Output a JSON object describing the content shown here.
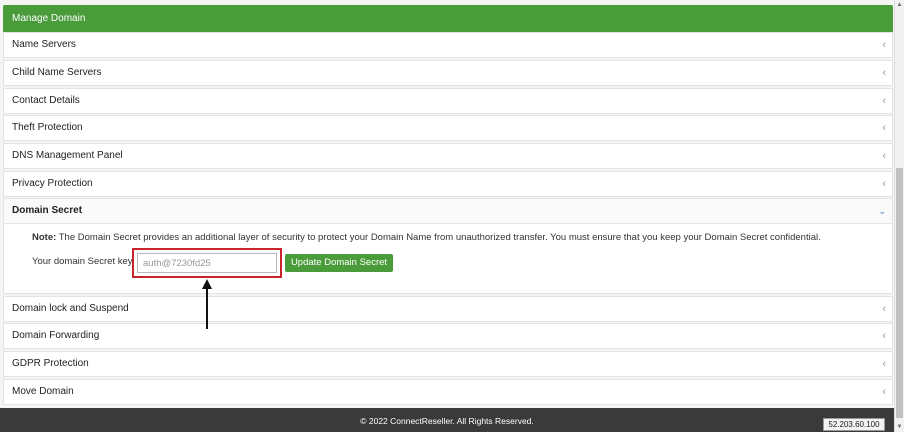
{
  "header": {
    "title": "Manage Domain"
  },
  "sections": [
    {
      "label": "Name Servers"
    },
    {
      "label": "Child Name Servers"
    },
    {
      "label": "Contact Details"
    },
    {
      "label": "Theft Protection"
    },
    {
      "label": "DNS Management Panel"
    },
    {
      "label": "Privacy Protection"
    },
    {
      "label": "Domain Secret",
      "expanded": true
    },
    {
      "label": "Domain lock and Suspend"
    },
    {
      "label": "Domain Forwarding"
    },
    {
      "label": "GDPR Protection"
    },
    {
      "label": "Move Domain"
    }
  ],
  "domain_secret": {
    "note_label": "Note:",
    "note_text": " The Domain Secret provides an additional layer of security to protect your Domain Name from unauthorized transfer. You must ensure that you keep your Domain Secret confidential.",
    "field_label": "Your domain Secret key",
    "field_value": "auth@7230fd25",
    "button_label": "Update Domain Secret"
  },
  "footer": {
    "copyright": "© 2022 ConnectReseller. All Rights Reserved."
  },
  "ip_address": "52.203.60.100",
  "icons": {
    "collapsed": "‹",
    "expanded": "⌄"
  },
  "colors": {
    "accent_green": "#4a9c3a",
    "highlight_red": "#c9242b",
    "footer_bg": "#3a3a3a"
  }
}
